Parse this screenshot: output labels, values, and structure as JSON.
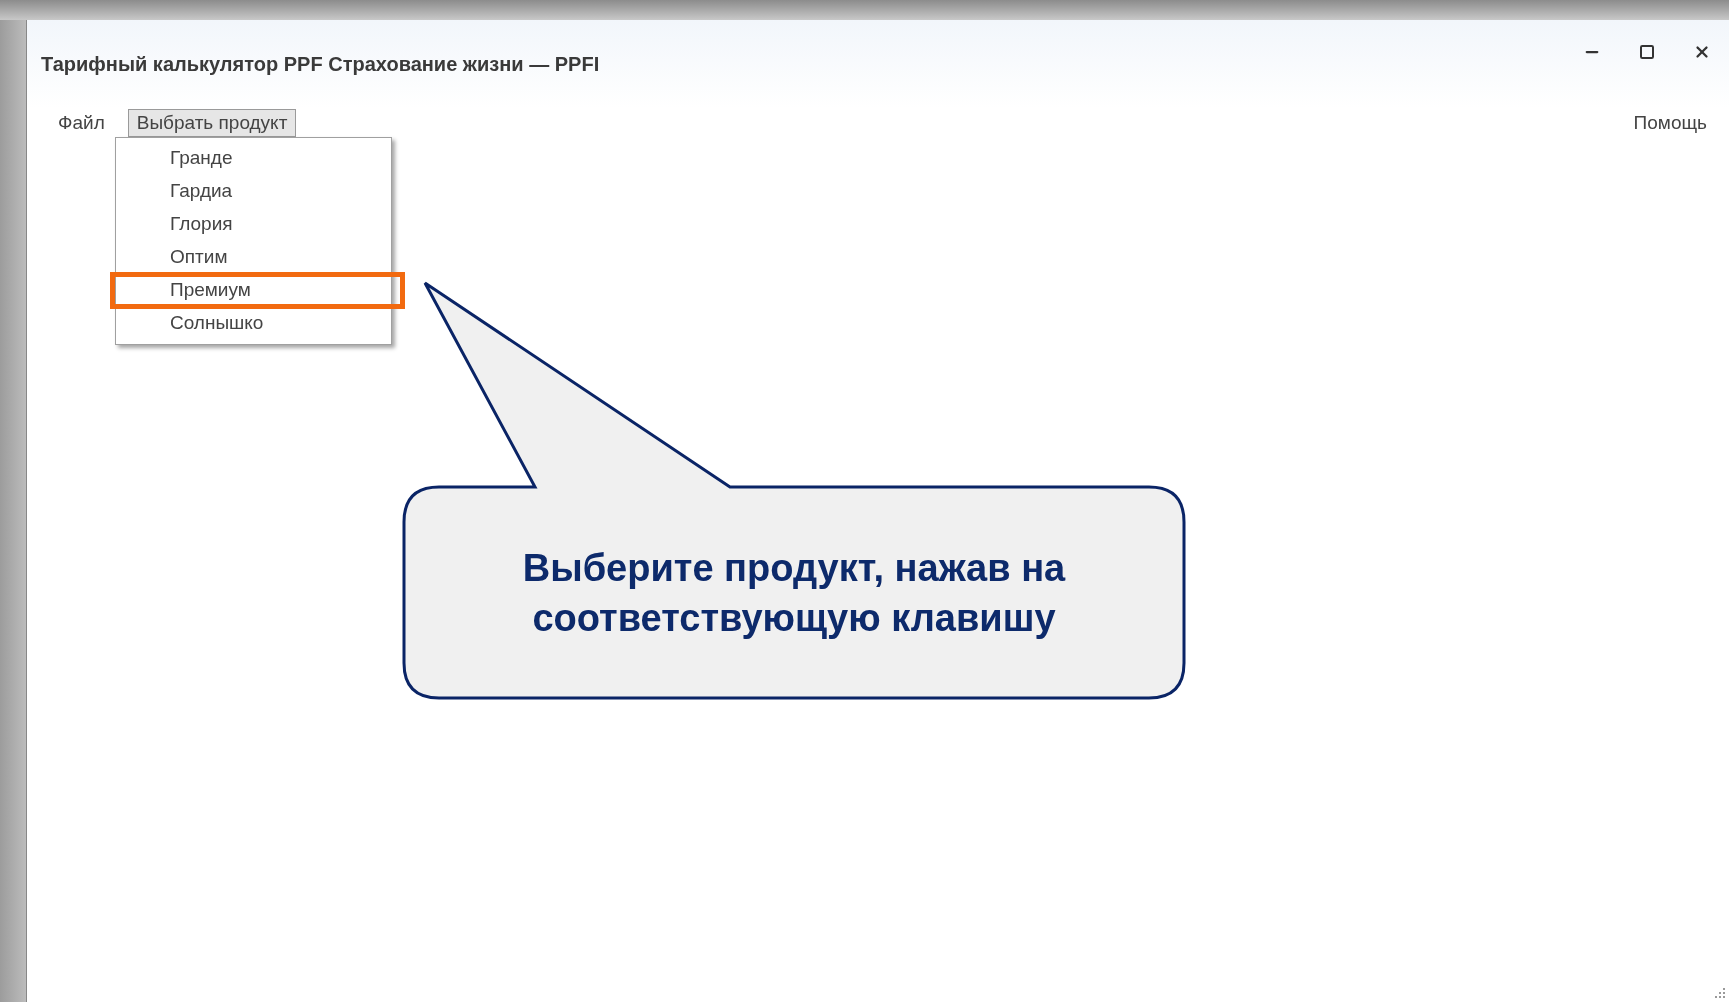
{
  "window": {
    "title": "Тарифный калькулятор PPF Страхование жизни — PPFI"
  },
  "menu_bar": {
    "items": [
      {
        "label": "Файл",
        "selected": false
      },
      {
        "label": "Выбрать продукт",
        "selected": true
      }
    ],
    "help": "Помощь"
  },
  "dropdown": {
    "items": [
      {
        "label": "Гранде",
        "highlighted": false
      },
      {
        "label": "Гардиа",
        "highlighted": false
      },
      {
        "label": "Глория",
        "highlighted": false
      },
      {
        "label": "Оптим",
        "highlighted": false
      },
      {
        "label": "Премиум",
        "highlighted": true
      },
      {
        "label": "Солнышко",
        "highlighted": false
      }
    ]
  },
  "callout": {
    "text": "Выберите продукт, нажав на соответствующую клавишу"
  }
}
